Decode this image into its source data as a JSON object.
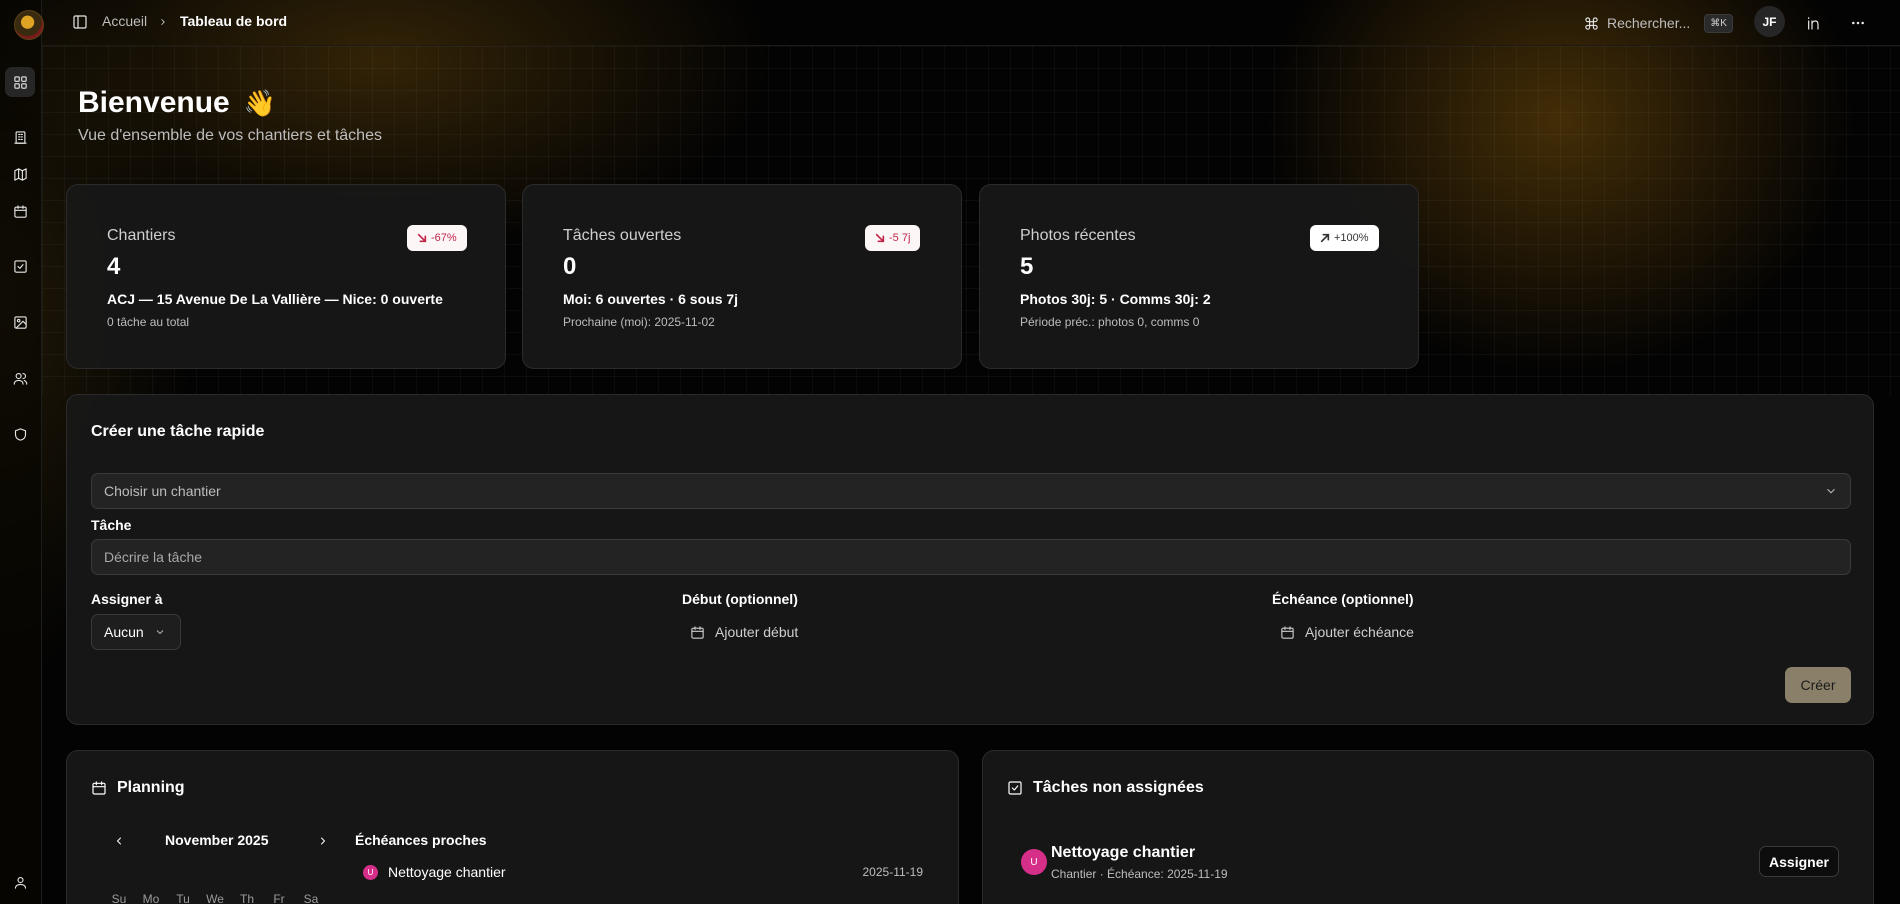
{
  "topbar": {
    "breadcrumb_home": "Accueil",
    "breadcrumb_current": "Tableau de bord",
    "search_label": "Rechercher...",
    "search_shortcut": "⌘K",
    "avatar_initials": "JF"
  },
  "header": {
    "title": "Bienvenue",
    "emoji": "👋",
    "subtitle": "Vue d'ensemble de vos chantiers et tâches"
  },
  "stats": [
    {
      "label": "Chantiers",
      "value": "4",
      "badge": "-67%",
      "trend": "down",
      "line": "ACJ — 15 Avenue De La Vallière — Nice: 0 ouverte",
      "foot": "0 tâche au total"
    },
    {
      "label": "Tâches ouvertes",
      "value": "0",
      "badge": "-5 7j",
      "trend": "down",
      "line": "Moi: 6 ouvertes · 6 sous 7j",
      "foot": "Prochaine (moi): 2025-11-02"
    },
    {
      "label": "Photos récentes",
      "value": "5",
      "badge": "+100%",
      "trend": "up",
      "line": "Photos 30j: 5 · Comms 30j: 2",
      "foot": "Période préc.: photos 0, comms 0"
    }
  ],
  "quick_task": {
    "title": "Créer une tâche rapide",
    "site_placeholder": "Choisir un chantier",
    "task_label": "Tâche",
    "task_placeholder": "Décrire la tâche",
    "assign_label": "Assigner à",
    "assign_value": "Aucun",
    "start_label": "Début (optionnel)",
    "start_button": "Ajouter début",
    "due_label": "Échéance (optionnel)",
    "due_button": "Ajouter échéance",
    "create_button": "Créer"
  },
  "planning": {
    "title": "Planning",
    "month": "November 2025",
    "weekdays": [
      "Su",
      "Mo",
      "Tu",
      "We",
      "Th",
      "Fr",
      "Sa"
    ],
    "upcoming_title": "Échéances proches",
    "upcoming": [
      {
        "initial": "U",
        "name": "Nettoyage chantier",
        "date": "2025-11-19"
      }
    ]
  },
  "unassigned": {
    "title": "Tâches non assignées",
    "tasks": [
      {
        "initial": "U",
        "name": "Nettoyage chantier",
        "meta": "Chantier · Échéance: 2025-11-19",
        "button": "Assigner"
      }
    ]
  },
  "colors": {
    "accent_pink": "#d62f8a",
    "create_button": "#8a8069",
    "badge_down_text": "#c0264b"
  }
}
